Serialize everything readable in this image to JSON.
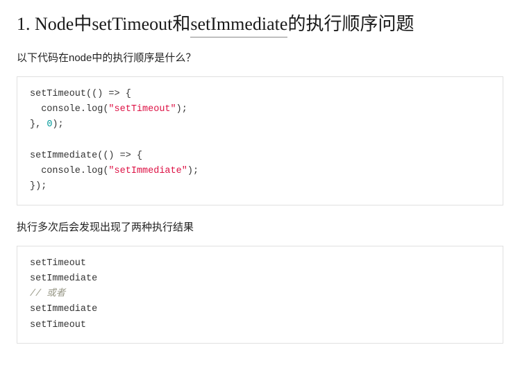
{
  "heading": {
    "prefix": "1. Node中setTimeout和",
    "underlined": "setImmediate",
    "suffix": "的执行顺序问题"
  },
  "paragraph1": "以下代码在node中的执行顺序是什么？",
  "code1": {
    "l1a": "setTimeout",
    "l1b": "(() ",
    "l1c": "=>",
    "l1d": " {",
    "l2a": "  console.log(",
    "l2b": "\"setTimeout\"",
    "l2c": ");",
    "l3a": "}, ",
    "l3b": "0",
    "l3c": ");",
    "l5a": "setImmediate",
    "l5b": "(() ",
    "l5c": "=>",
    "l5d": " {",
    "l6a": "  console.log(",
    "l6b": "\"setImmediate\"",
    "l6c": ");",
    "l7a": "});"
  },
  "paragraph2": "执行多次后会发现出现了两种执行结果",
  "code2": {
    "l1": "setTimeout",
    "l2": "setImmediate",
    "l3": "// 或者",
    "l4": "setImmediate",
    "l5": "setTimeout"
  }
}
